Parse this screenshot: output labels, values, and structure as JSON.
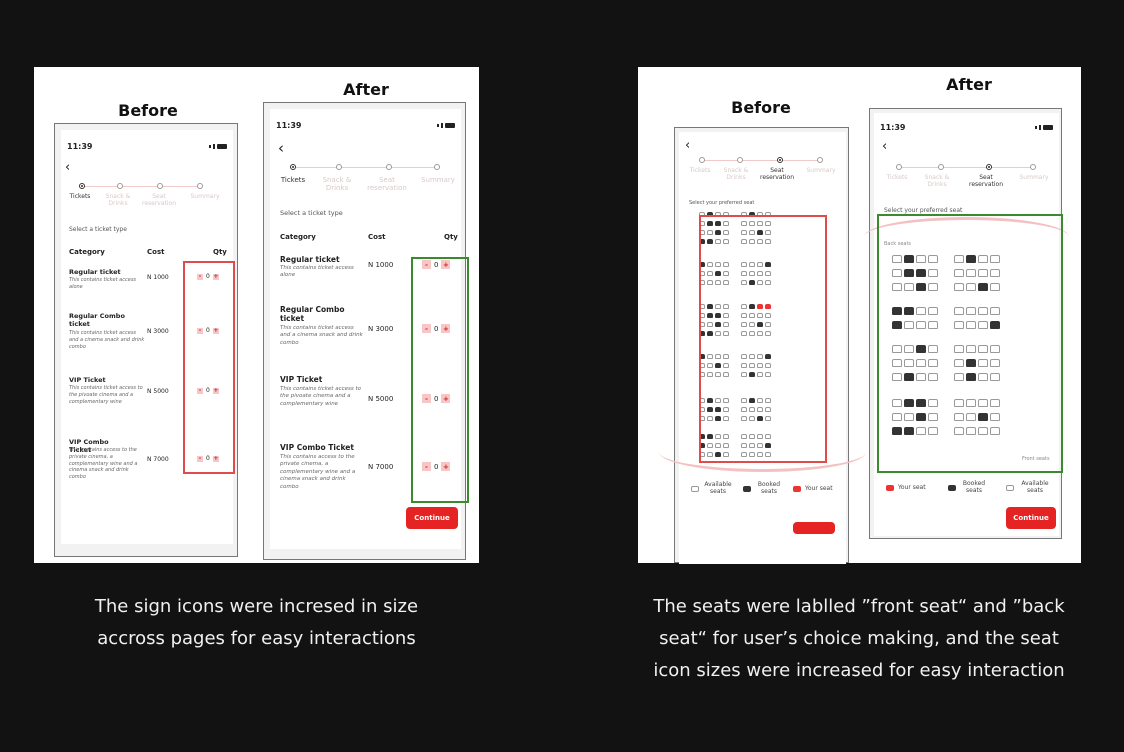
{
  "left": {
    "before_label": "Before",
    "after_label": "After",
    "before": {
      "time": "11:39",
      "steps": [
        "Tickets",
        "Snack & Drinks",
        "Seat reservation",
        "Summary"
      ],
      "select_text": "Select a ticket type",
      "headers": {
        "category": "Category",
        "cost": "Cost",
        "qty": "Qty"
      },
      "tickets": [
        {
          "name": "Regular ticket",
          "desc": "This contains ticket access alone",
          "price": "N 1000",
          "qty": "0"
        },
        {
          "name": "Regular Combo ticket",
          "desc": "This contains ticket access and a cinema snack and drink combo",
          "price": "N 3000",
          "qty": "0"
        },
        {
          "name": "VIP Ticket",
          "desc": "This contains ticket access to the pivoate cinema and a complementary wine",
          "price": "N 5000",
          "qty": "0"
        },
        {
          "name": "VIP Combo Ticket",
          "desc": "This contains access to the private cinema, a complementary wine and a cinema snack and drink combo",
          "price": "N 7000",
          "qty": "0"
        }
      ],
      "minus": "-",
      "plus": "+"
    },
    "after": {
      "time": "11:39",
      "steps": [
        "Tickets",
        "Snack & Drinks",
        "Seat reservation",
        "Summary"
      ],
      "select_text": "Select a ticket type",
      "headers": {
        "category": "Category",
        "cost": "Cost",
        "qty": "Qty"
      },
      "tickets": [
        {
          "name": "Regular ticket",
          "desc": "This contains ticket access alone",
          "price": "N 1000",
          "qty": "0"
        },
        {
          "name": "Regular Combo ticket",
          "desc": "This contains ticket access and a cinema snack and drink combo",
          "price": "N 3000",
          "qty": "0"
        },
        {
          "name": "VIP Ticket",
          "desc": "This contains ticket access to the pivoate cinema and a complementary wine",
          "price": "N 5000",
          "qty": "0"
        },
        {
          "name": "VIP Combo Ticket",
          "desc": "This contains access to the private cinema, a complementary wine and a cinema snack and drink combo",
          "price": "N 7000",
          "qty": "0"
        }
      ],
      "minus": "-",
      "plus": "+",
      "continue": "Continue"
    },
    "caption": [
      "The sign icons were incresed in size",
      "accross pages for easy interactions"
    ]
  },
  "right": {
    "before_label": "Before",
    "after_label": "After",
    "before": {
      "steps": [
        "Tickets",
        "Snack & Drinks",
        "Seat reservation",
        "Summary"
      ],
      "select_text": "Select your preferred seat",
      "legend": {
        "available": "Available seats",
        "booked": "Booked seats",
        "yours": "Your seat"
      }
    },
    "after": {
      "time": "11:39",
      "steps": [
        "Tickets",
        "Snack & Drinks",
        "Seat reservation",
        "Summary"
      ],
      "select_text": "Select your preferred seat",
      "back_seats": "Back seats",
      "front_seats": "Front seats",
      "legend": {
        "yours": "Your seat",
        "booked": "Booked seats",
        "available": "Available seats"
      },
      "continue": "Continue"
    },
    "caption": [
      "The seats were lablled ”front seat“ and ”back",
      "seat“ for user’s choice making, and the seat",
      "icon sizes were increased for easy interaction"
    ]
  },
  "colors": {
    "accent": "#e62323",
    "before_box": "#e04b4b",
    "after_box": "#3a8a2e",
    "background": "#121212"
  }
}
